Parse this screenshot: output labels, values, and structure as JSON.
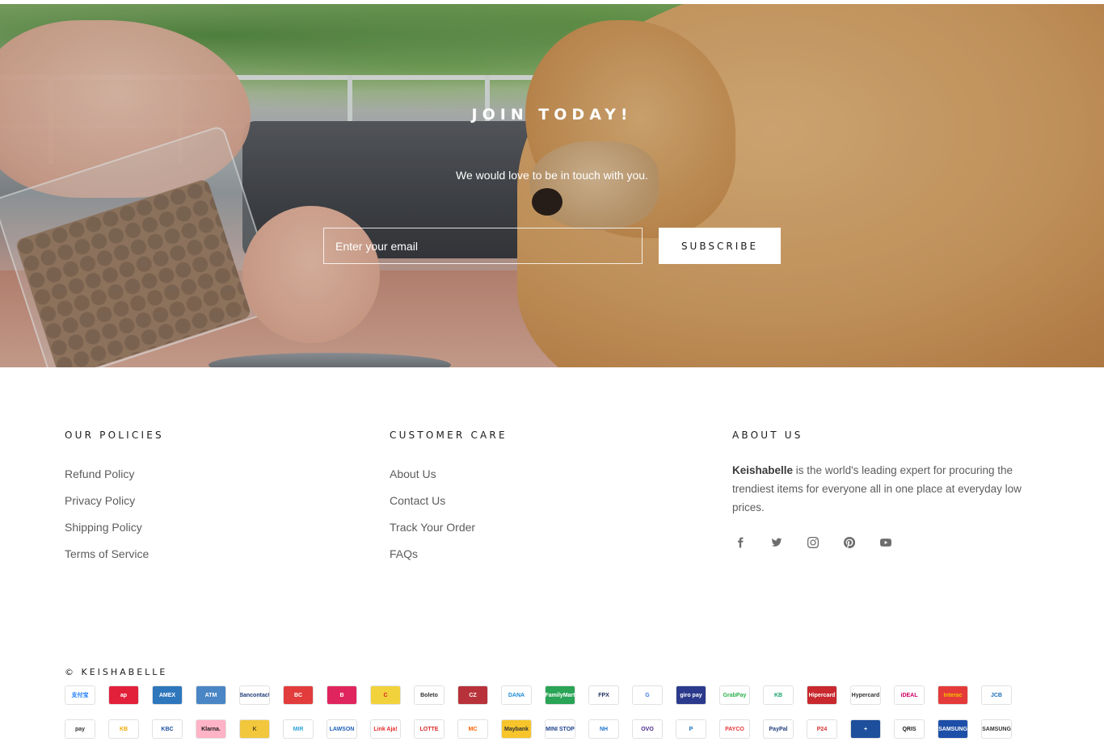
{
  "newsletter": {
    "title": "JOIN TODAY!",
    "subtitle": "We would love to be in touch with you.",
    "email_placeholder": "Enter your email",
    "subscribe_label": "SUBSCRIBE"
  },
  "footer": {
    "policies": {
      "heading": "OUR POLICIES",
      "links": [
        "Refund Policy",
        "Privacy Policy",
        "Shipping Policy",
        "Terms of Service"
      ]
    },
    "customer_care": {
      "heading": "CUSTOMER CARE",
      "links": [
        "About Us",
        "Contact Us",
        "Track Your Order",
        "FAQs"
      ]
    },
    "about": {
      "heading": "ABOUT US",
      "brand": "Keishabelle",
      "text": " is the world's leading expert for procuring the trendiest items for everyone all in one place at everyday low prices.",
      "social": [
        "facebook-icon",
        "twitter-icon",
        "instagram-icon",
        "pinterest-icon",
        "youtube-icon"
      ]
    },
    "copyright": "© KEISHABELLE"
  },
  "payment_row_1": [
    {
      "label": "支付宝",
      "color": "#1677ff",
      "bg": "#fff"
    },
    {
      "label": "ap",
      "color": "#fff",
      "bg": "#e2203a"
    },
    {
      "label": "AMEX",
      "color": "#fff",
      "bg": "#2e77bc"
    },
    {
      "label": "ATM",
      "color": "#fff",
      "bg": "#4a86c5"
    },
    {
      "label": "Bancontact",
      "color": "#1e3c7a",
      "bg": "#fff"
    },
    {
      "label": "BC",
      "color": "#fff",
      "bg": "#e23c3c"
    },
    {
      "label": "B",
      "color": "#fff",
      "bg": "#e0245e"
    },
    {
      "label": "C",
      "color": "#d62020",
      "bg": "#f2d23c"
    },
    {
      "label": "Boleto",
      "color": "#333",
      "bg": "#fff"
    },
    {
      "label": "CZ",
      "color": "#fff",
      "bg": "#b7323a"
    },
    {
      "label": "DANA",
      "color": "#1e8bd6",
      "bg": "#fff"
    },
    {
      "label": "FamilyMart",
      "color": "#fff",
      "bg": "#2aa456"
    },
    {
      "label": "FPX",
      "color": "#1a2e5c",
      "bg": "#fff"
    },
    {
      "label": "G",
      "color": "#3d7be0",
      "bg": "#fff"
    },
    {
      "label": "giro pay",
      "color": "#fff",
      "bg": "#2b3a8c"
    },
    {
      "label": "GrabPay",
      "color": "#2bb14c",
      "bg": "#fff"
    },
    {
      "label": "KB",
      "color": "#1aa36b",
      "bg": "#fff"
    },
    {
      "label": "Hipercard",
      "color": "#fff",
      "bg": "#c8282e"
    },
    {
      "label": "Hypercard",
      "color": "#333",
      "bg": "#fff"
    },
    {
      "label": "iDEAL",
      "color": "#cc0066",
      "bg": "#fff"
    },
    {
      "label": "Interac",
      "color": "#f2c200",
      "bg": "#e53a3a"
    },
    {
      "label": "JCB",
      "color": "#1d6fb8",
      "bg": "#fff"
    }
  ],
  "payment_row_2": [
    {
      "label": "pay",
      "color": "#333",
      "bg": "#fff"
    },
    {
      "label": "KB",
      "color": "#f2a900",
      "bg": "#fff"
    },
    {
      "label": "KBC",
      "color": "#1d4fa0",
      "bg": "#fff"
    },
    {
      "label": "Klarna.",
      "color": "#1c1b1b",
      "bg": "#ffb3c7"
    },
    {
      "label": "K",
      "color": "#5c4a1e",
      "bg": "#f2c73c"
    },
    {
      "label": "MIR",
      "color": "#2fa3d9",
      "bg": "#fff"
    },
    {
      "label": "LAWSON",
      "color": "#1d5fb8",
      "bg": "#fff"
    },
    {
      "label": "Link Aja!",
      "color": "#e52a2a",
      "bg": "#fff"
    },
    {
      "label": "LOTTE",
      "color": "#d82a2a",
      "bg": "#fff"
    },
    {
      "label": "MC",
      "color": "#ff5f00",
      "bg": "#fff"
    },
    {
      "label": "Maybank",
      "color": "#333",
      "bg": "#f7c52b"
    },
    {
      "label": "MINI STOP",
      "color": "#1d3f8a",
      "bg": "#fff"
    },
    {
      "label": "NH",
      "color": "#1b73c9",
      "bg": "#fff"
    },
    {
      "label": "OVO",
      "color": "#4b2a8c",
      "bg": "#fff"
    },
    {
      "label": "P",
      "color": "#1d6fb8",
      "bg": "#fff"
    },
    {
      "label": "PAYCO",
      "color": "#e53a3a",
      "bg": "#fff"
    },
    {
      "label": "PayPal",
      "color": "#1e3c7a",
      "bg": "#fff"
    },
    {
      "label": "P24",
      "color": "#d32f2f",
      "bg": "#fff"
    },
    {
      "label": "+",
      "color": "#fff",
      "bg": "#1e4f9c"
    },
    {
      "label": "QRIS",
      "color": "#1c1b1b",
      "bg": "#fff"
    },
    {
      "label": "SAMSUNG",
      "color": "#fff",
      "bg": "#1e4fa8"
    },
    {
      "label": "SAMSUNG",
      "color": "#333",
      "bg": "#fff"
    }
  ]
}
